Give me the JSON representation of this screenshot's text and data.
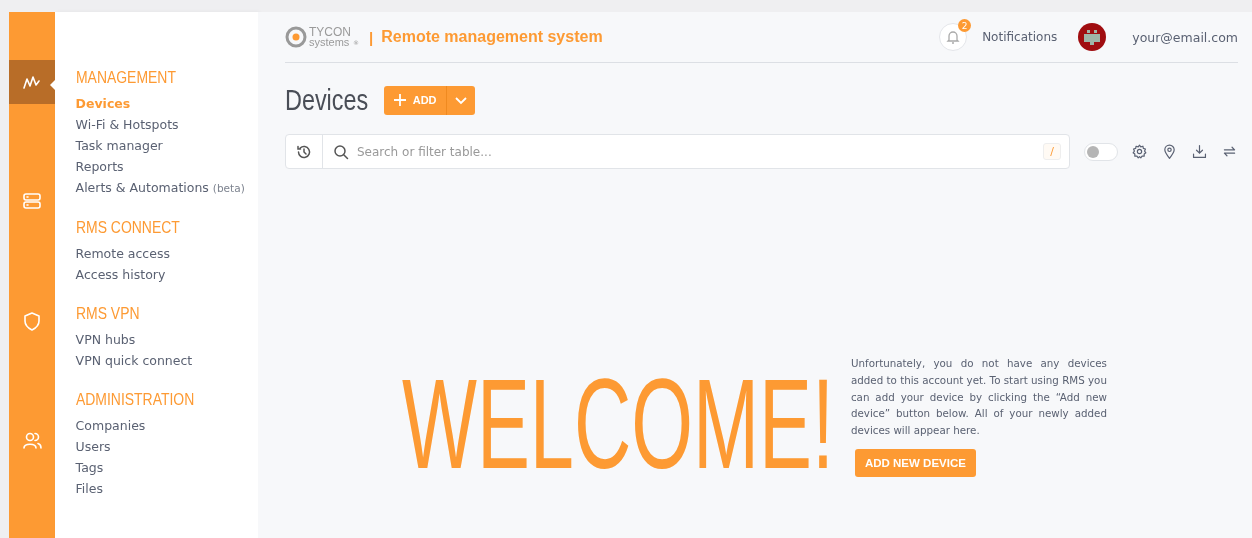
{
  "rail": [
    {
      "selected": true
    },
    {
      "selected": false
    },
    {
      "selected": false
    },
    {
      "selected": false
    }
  ],
  "sidebar": {
    "sections": [
      {
        "title": "MANAGEMENT",
        "items": [
          {
            "label": "Devices",
            "selected": true
          },
          {
            "label": "Wi-Fi & Hotspots",
            "selected": false
          },
          {
            "label": "Task manager",
            "selected": false
          },
          {
            "label": "Reports",
            "selected": false
          },
          {
            "label": "Alerts & Automations",
            "suffix": "(beta)",
            "selected": false
          }
        ]
      },
      {
        "title": "RMS CONNECT",
        "items": [
          {
            "label": "Remote access",
            "selected": false
          },
          {
            "label": "Access history",
            "selected": false
          }
        ]
      },
      {
        "title": "RMS VPN",
        "items": [
          {
            "label": "VPN hubs",
            "selected": false
          },
          {
            "label": "VPN quick connect",
            "selected": false
          }
        ]
      },
      {
        "title": "ADMINISTRATION",
        "items": [
          {
            "label": "Companies",
            "selected": false
          },
          {
            "label": "Users",
            "selected": false
          },
          {
            "label": "Tags",
            "selected": false
          },
          {
            "label": "Files",
            "selected": false
          }
        ]
      }
    ]
  },
  "header": {
    "logo_top": "TYCON",
    "logo_bottom": "systems",
    "logo_mark": "®",
    "separator": "|",
    "app_title": "Remote management system",
    "notification_count": "2",
    "notifications_label": "Notifications",
    "email": "your@email.com"
  },
  "page": {
    "title": "Devices",
    "add_button": "ADD",
    "search": {
      "placeholder": "Search or filter table...",
      "shortcut": "/"
    },
    "toggle": {
      "on": false
    }
  },
  "welcome": {
    "heading": "WELCOME!",
    "text": "Unfortunately, you do not have any devices added to this account yet. To start using RMS you can add your device by clicking the “Add new device” button below. All of your newly added devices will appear here.",
    "button": "ADD NEW DEVICE"
  }
}
